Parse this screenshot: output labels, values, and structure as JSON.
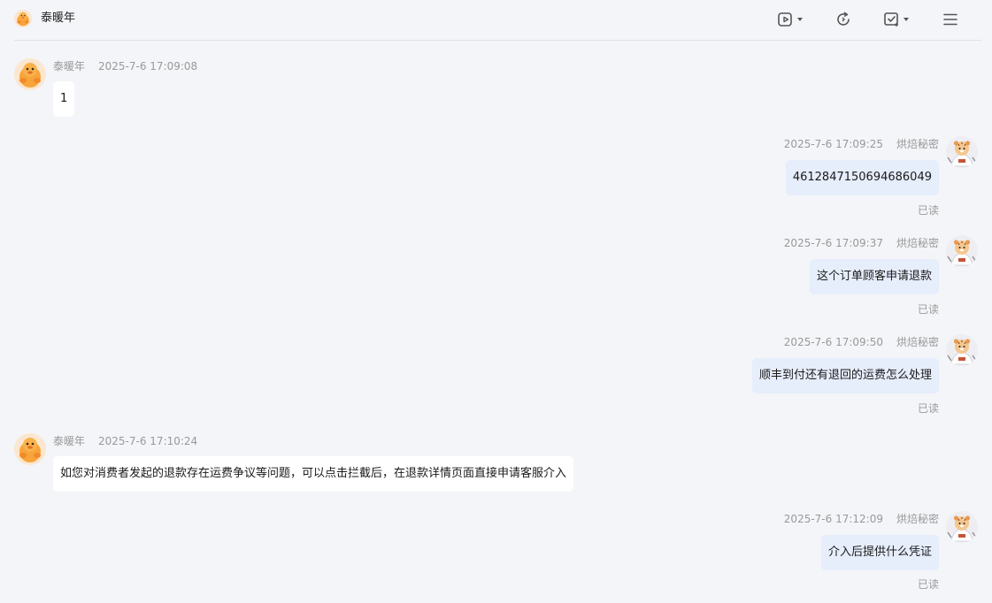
{
  "header": {
    "title": "泰暖年",
    "buttons": [
      "video-icon",
      "refresh-icon",
      "checklist-icon",
      "menu-icon"
    ]
  },
  "messages": [
    {
      "side": "left",
      "sender": "泰暖年",
      "time": "2025-7-6 17:09:08",
      "text": "1"
    },
    {
      "side": "right",
      "sender": "烘焙秘密",
      "time": "2025-7-6 17:09:25",
      "text": "4612847150694686049",
      "status": "已读"
    },
    {
      "side": "right",
      "sender": "烘焙秘密",
      "time": "2025-7-6 17:09:37",
      "text": "这个订单顾客申请退款",
      "status": "已读"
    },
    {
      "side": "right",
      "sender": "烘焙秘密",
      "time": "2025-7-6 17:09:50",
      "text": "顺丰到付还有退回的运费怎么处理",
      "status": "已读"
    },
    {
      "side": "left",
      "sender": "泰暖年",
      "time": "2025-7-6 17:10:24",
      "text": "如您对消费者发起的退款存在运费争议等问题，可以点击拦截后，在退款详情页面直接申请客服介入"
    },
    {
      "side": "right",
      "sender": "烘焙秘密",
      "time": "2025-7-6 17:12:09",
      "text": "介入后提供什么凭证",
      "status": "已读"
    }
  ],
  "colors": {
    "background": "#f4f5f8",
    "incoming_bubble": "#ffffff",
    "outgoing_bubble": "#e6edfb",
    "meta_text": "#999999"
  }
}
